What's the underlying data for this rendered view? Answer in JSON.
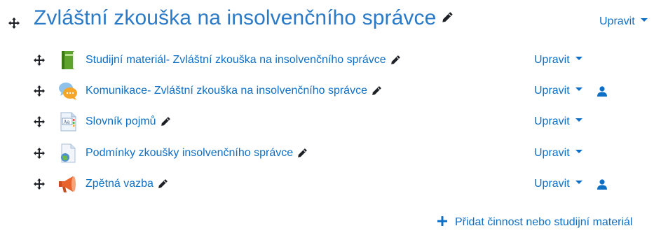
{
  "section": {
    "title": "Zvláštní zkouška na insolvenčního správce",
    "edit_label": "Upravit"
  },
  "activities": [
    {
      "name": "Studijní materiál- Zvláštní zkouška na insolvenčního správce",
      "icon": "book-icon",
      "edit_label": "Upravit",
      "has_user_icon": false
    },
    {
      "name": "Komunikace- Zvláštní zkouška na insolvenčního správce",
      "icon": "forum-icon",
      "edit_label": "Upravit",
      "has_user_icon": true
    },
    {
      "name": "Slovník pojmů",
      "icon": "glossary-icon",
      "edit_label": "Upravit",
      "has_user_icon": false
    },
    {
      "name": "Podmínky zkoušky insolvenčního správce",
      "icon": "page-icon",
      "edit_label": "Upravit",
      "has_user_icon": false
    },
    {
      "name": "Zpětná vazba",
      "icon": "feedback-icon",
      "edit_label": "Upravit",
      "has_user_icon": true
    }
  ],
  "add_activity_label": "Přidat činnost nebo studijní materiál",
  "colors": {
    "link": "#0f6fc5",
    "title": "#2b7ac8",
    "text_dark": "#1d2125"
  }
}
